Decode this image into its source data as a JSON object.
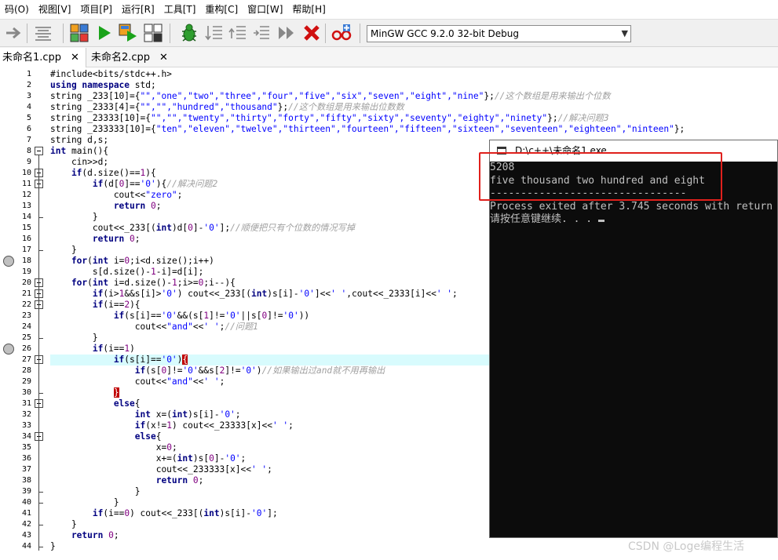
{
  "menu": [
    "码(O)",
    "视图[V]",
    "项目[P]",
    "运行[R]",
    "工具[T]",
    "重构[C]",
    "窗口[W]",
    "帮助[H]"
  ],
  "compiler_select": "MinGW GCC 9.2.0 32-bit Debug",
  "tabs": [
    {
      "label": "未命名1.cpp",
      "close": "✕"
    },
    {
      "label": "未命名2.cpp",
      "close": "✕"
    }
  ],
  "line_numbers": [
    "1",
    "2",
    "3",
    "4",
    "5",
    "6",
    "7",
    "8",
    "9",
    "10",
    "11",
    "12",
    "13",
    "14",
    "15",
    "16",
    "17",
    "18",
    "19",
    "20",
    "21",
    "22",
    "23",
    "24",
    "25",
    "26",
    "27",
    "28",
    "29",
    "30",
    "31",
    "32",
    "33",
    "34",
    "35",
    "36",
    "37",
    "38",
    "39",
    "40",
    "41",
    "42",
    "43",
    "44"
  ],
  "code_lines": [
    [
      [
        "pp",
        "#include<bits/stdc++.h>"
      ]
    ],
    [
      [
        "kw",
        "using namespace "
      ],
      [
        "tx",
        "std;"
      ]
    ],
    [
      [
        "tx",
        "string _233[10]={"
      ],
      [
        "st",
        "\"\",\"one\",\"two\",\"three\",\"four\",\"five\",\"six\",\"seven\",\"eight\",\"nine\""
      ],
      [
        "tx",
        "};"
      ],
      [
        "cm",
        "//这个数组是用来输出个位数"
      ]
    ],
    [
      [
        "tx",
        "string _2333[4]={"
      ],
      [
        "st",
        "\"\",\"\",\"hundred\",\"thousand\""
      ],
      [
        "tx",
        "};"
      ],
      [
        "cm",
        "//这个数组是用来输出位数数"
      ]
    ],
    [
      [
        "tx",
        "string _23333[10]={"
      ],
      [
        "st",
        "\"\",\"\",\"twenty\",\"thirty\",\"forty\",\"fifty\",\"sixty\",\"seventy\",\"eighty\",\"ninety\""
      ],
      [
        "tx",
        "};"
      ],
      [
        "cm",
        "//解决问题3"
      ]
    ],
    [
      [
        "tx",
        "string _233333[10]={"
      ],
      [
        "st",
        "\"ten\",\"eleven\",\"twelve\",\"thirteen\",\"fourteen\",\"fifteen\",\"sixteen\",\"seventeen\",\"eighteen\",\"ninteen\""
      ],
      [
        "tx",
        "};"
      ]
    ],
    [
      [
        "tx",
        "string d,s;"
      ]
    ],
    [
      [
        "kw",
        "int "
      ],
      [
        "tx",
        "main(){"
      ]
    ],
    [
      [
        "tx",
        "    cin>>d;"
      ]
    ],
    [
      [
        "kw",
        "    if"
      ],
      [
        "tx",
        "(d.size()=="
      ],
      [
        "nm",
        "1"
      ],
      [
        "tx",
        "){"
      ]
    ],
    [
      [
        "kw",
        "        if"
      ],
      [
        "tx",
        "(d["
      ],
      [
        "nm",
        "0"
      ],
      [
        "tx",
        "]=="
      ],
      [
        "st",
        "'0'"
      ],
      [
        "tx",
        "){"
      ],
      [
        "cm",
        "//解决问题2"
      ]
    ],
    [
      [
        "tx",
        "            cout<<"
      ],
      [
        "st",
        "\"zero\""
      ],
      [
        "tx",
        ";"
      ]
    ],
    [
      [
        "kw",
        "            return "
      ],
      [
        "nm",
        "0"
      ],
      [
        "tx",
        ";"
      ]
    ],
    [
      [
        "tx",
        "        }"
      ]
    ],
    [
      [
        "tx",
        "        cout<<_233[("
      ],
      [
        "kw",
        "int"
      ],
      [
        "tx",
        ")d["
      ],
      [
        "nm",
        "0"
      ],
      [
        "tx",
        "]-"
      ],
      [
        "st",
        "'0'"
      ],
      [
        "tx",
        "];"
      ],
      [
        "cm",
        "//顺便把只有个位数的情况写掉"
      ]
    ],
    [
      [
        "kw",
        "        return "
      ],
      [
        "nm",
        "0"
      ],
      [
        "tx",
        ";"
      ]
    ],
    [
      [
        "tx",
        "    }"
      ]
    ],
    [
      [
        "kw",
        "    for"
      ],
      [
        "tx",
        "("
      ],
      [
        "kw",
        "int "
      ],
      [
        "tx",
        "i="
      ],
      [
        "nm",
        "0"
      ],
      [
        "tx",
        ";i<d.size();i++)"
      ]
    ],
    [
      [
        "tx",
        "        s[d.size()-"
      ],
      [
        "nm",
        "1"
      ],
      [
        "tx",
        "-i]=d[i];"
      ]
    ],
    [
      [
        "kw",
        "    for"
      ],
      [
        "tx",
        "("
      ],
      [
        "kw",
        "int "
      ],
      [
        "tx",
        "i=d.size()-"
      ],
      [
        "nm",
        "1"
      ],
      [
        "tx",
        ";i>="
      ],
      [
        "nm",
        "0"
      ],
      [
        "tx",
        ";i--){"
      ]
    ],
    [
      [
        "kw",
        "        if"
      ],
      [
        "tx",
        "(i>"
      ],
      [
        "nm",
        "1"
      ],
      [
        "tx",
        "&&s[i]>"
      ],
      [
        "st",
        "'0'"
      ],
      [
        "tx",
        ") cout<<_233[("
      ],
      [
        "kw",
        "int"
      ],
      [
        "tx",
        ")s[i]-"
      ],
      [
        "st",
        "'0'"
      ],
      [
        "tx",
        "]<<"
      ],
      [
        "st",
        "' '"
      ],
      [
        "tx",
        ",cout<<_2333[i]<<"
      ],
      [
        "st",
        "' '"
      ],
      [
        "tx",
        ";"
      ]
    ],
    [
      [
        "kw",
        "        if"
      ],
      [
        "tx",
        "(i=="
      ],
      [
        "nm",
        "2"
      ],
      [
        "tx",
        "){"
      ]
    ],
    [
      [
        "kw",
        "            if"
      ],
      [
        "tx",
        "(s[i]=="
      ],
      [
        "st",
        "'0'"
      ],
      [
        "tx",
        "&&(s["
      ],
      [
        "nm",
        "1"
      ],
      [
        "tx",
        "]!="
      ],
      [
        "st",
        "'0'"
      ],
      [
        "tx",
        "||s["
      ],
      [
        "nm",
        "0"
      ],
      [
        "tx",
        "]!="
      ],
      [
        "st",
        "'0'"
      ],
      [
        "tx",
        "))"
      ]
    ],
    [
      [
        "tx",
        "                cout<<"
      ],
      [
        "st",
        "\"and\""
      ],
      [
        "tx",
        "<<"
      ],
      [
        "st",
        "' '"
      ],
      [
        "tx",
        ";"
      ],
      [
        "cm",
        "//问题1"
      ]
    ],
    [
      [
        "tx",
        "        }"
      ]
    ],
    [
      [
        "kw",
        "        if"
      ],
      [
        "tx",
        "(i=="
      ],
      [
        "nm",
        "1"
      ],
      [
        "tx",
        ")"
      ]
    ],
    [
      [
        "kw",
        "            if"
      ],
      [
        "tx",
        "(s[i]=="
      ],
      [
        "st",
        "'0'"
      ],
      [
        "tx",
        ")"
      ],
      [
        "br",
        "{"
      ]
    ],
    [
      [
        "kw",
        "                if"
      ],
      [
        "tx",
        "(s["
      ],
      [
        "nm",
        "0"
      ],
      [
        "tx",
        "]!="
      ],
      [
        "st",
        "'0'"
      ],
      [
        "tx",
        "&&s["
      ],
      [
        "nm",
        "2"
      ],
      [
        "tx",
        "]!="
      ],
      [
        "st",
        "'0'"
      ],
      [
        "tx",
        ")"
      ],
      [
        "cm",
        "//如果输出过and就不用再输出"
      ]
    ],
    [
      [
        "tx",
        "                cout<<"
      ],
      [
        "st",
        "\"and\""
      ],
      [
        "tx",
        "<<"
      ],
      [
        "st",
        "' '"
      ],
      [
        "tx",
        ";"
      ]
    ],
    [
      [
        "tx",
        "            "
      ],
      [
        "br",
        "}"
      ]
    ],
    [
      [
        "kw",
        "            else"
      ],
      [
        "tx",
        "{"
      ]
    ],
    [
      [
        "kw",
        "                int "
      ],
      [
        "tx",
        "x=("
      ],
      [
        "kw",
        "int"
      ],
      [
        "tx",
        ")s[i]-"
      ],
      [
        "st",
        "'0'"
      ],
      [
        "tx",
        ";"
      ]
    ],
    [
      [
        "kw",
        "                if"
      ],
      [
        "tx",
        "(x!="
      ],
      [
        "nm",
        "1"
      ],
      [
        "tx",
        ") cout<<_23333[x]<<"
      ],
      [
        "st",
        "' '"
      ],
      [
        "tx",
        ";"
      ]
    ],
    [
      [
        "kw",
        "                else"
      ],
      [
        "tx",
        "{"
      ]
    ],
    [
      [
        "tx",
        "                    x="
      ],
      [
        "nm",
        "0"
      ],
      [
        "tx",
        ";"
      ]
    ],
    [
      [
        "tx",
        "                    x+=("
      ],
      [
        "kw",
        "int"
      ],
      [
        "tx",
        ")s["
      ],
      [
        "nm",
        "0"
      ],
      [
        "tx",
        "]-"
      ],
      [
        "st",
        "'0'"
      ],
      [
        "tx",
        ";"
      ]
    ],
    [
      [
        "tx",
        "                    cout<<_233333[x]<<"
      ],
      [
        "st",
        "' '"
      ],
      [
        "tx",
        ";"
      ]
    ],
    [
      [
        "kw",
        "                    return "
      ],
      [
        "nm",
        "0"
      ],
      [
        "tx",
        ";"
      ]
    ],
    [
      [
        "tx",
        "                }"
      ]
    ],
    [
      [
        "tx",
        "            }"
      ]
    ],
    [
      [
        "kw",
        "        if"
      ],
      [
        "tx",
        "(i=="
      ],
      [
        "nm",
        "0"
      ],
      [
        "tx",
        ") cout<<_233[("
      ],
      [
        "kw",
        "int"
      ],
      [
        "tx",
        ")s[i]-"
      ],
      [
        "st",
        "'0'"
      ],
      [
        "tx",
        "];"
      ]
    ],
    [
      [
        "tx",
        "    }"
      ]
    ],
    [
      [
        "kw",
        "    return "
      ],
      [
        "nm",
        "0"
      ],
      [
        "tx",
        ";"
      ]
    ],
    [
      [
        "tx",
        "}"
      ]
    ]
  ],
  "console": {
    "title": "D:\\c++\\未命名1.exe",
    "lines": [
      "5208",
      "five thousand two hundred and eight",
      "--------------------------------",
      "Process exited after 3.745 seconds with return",
      "请按任意键继续. . . "
    ]
  },
  "watermark": "CSDN @Loge编程生活"
}
